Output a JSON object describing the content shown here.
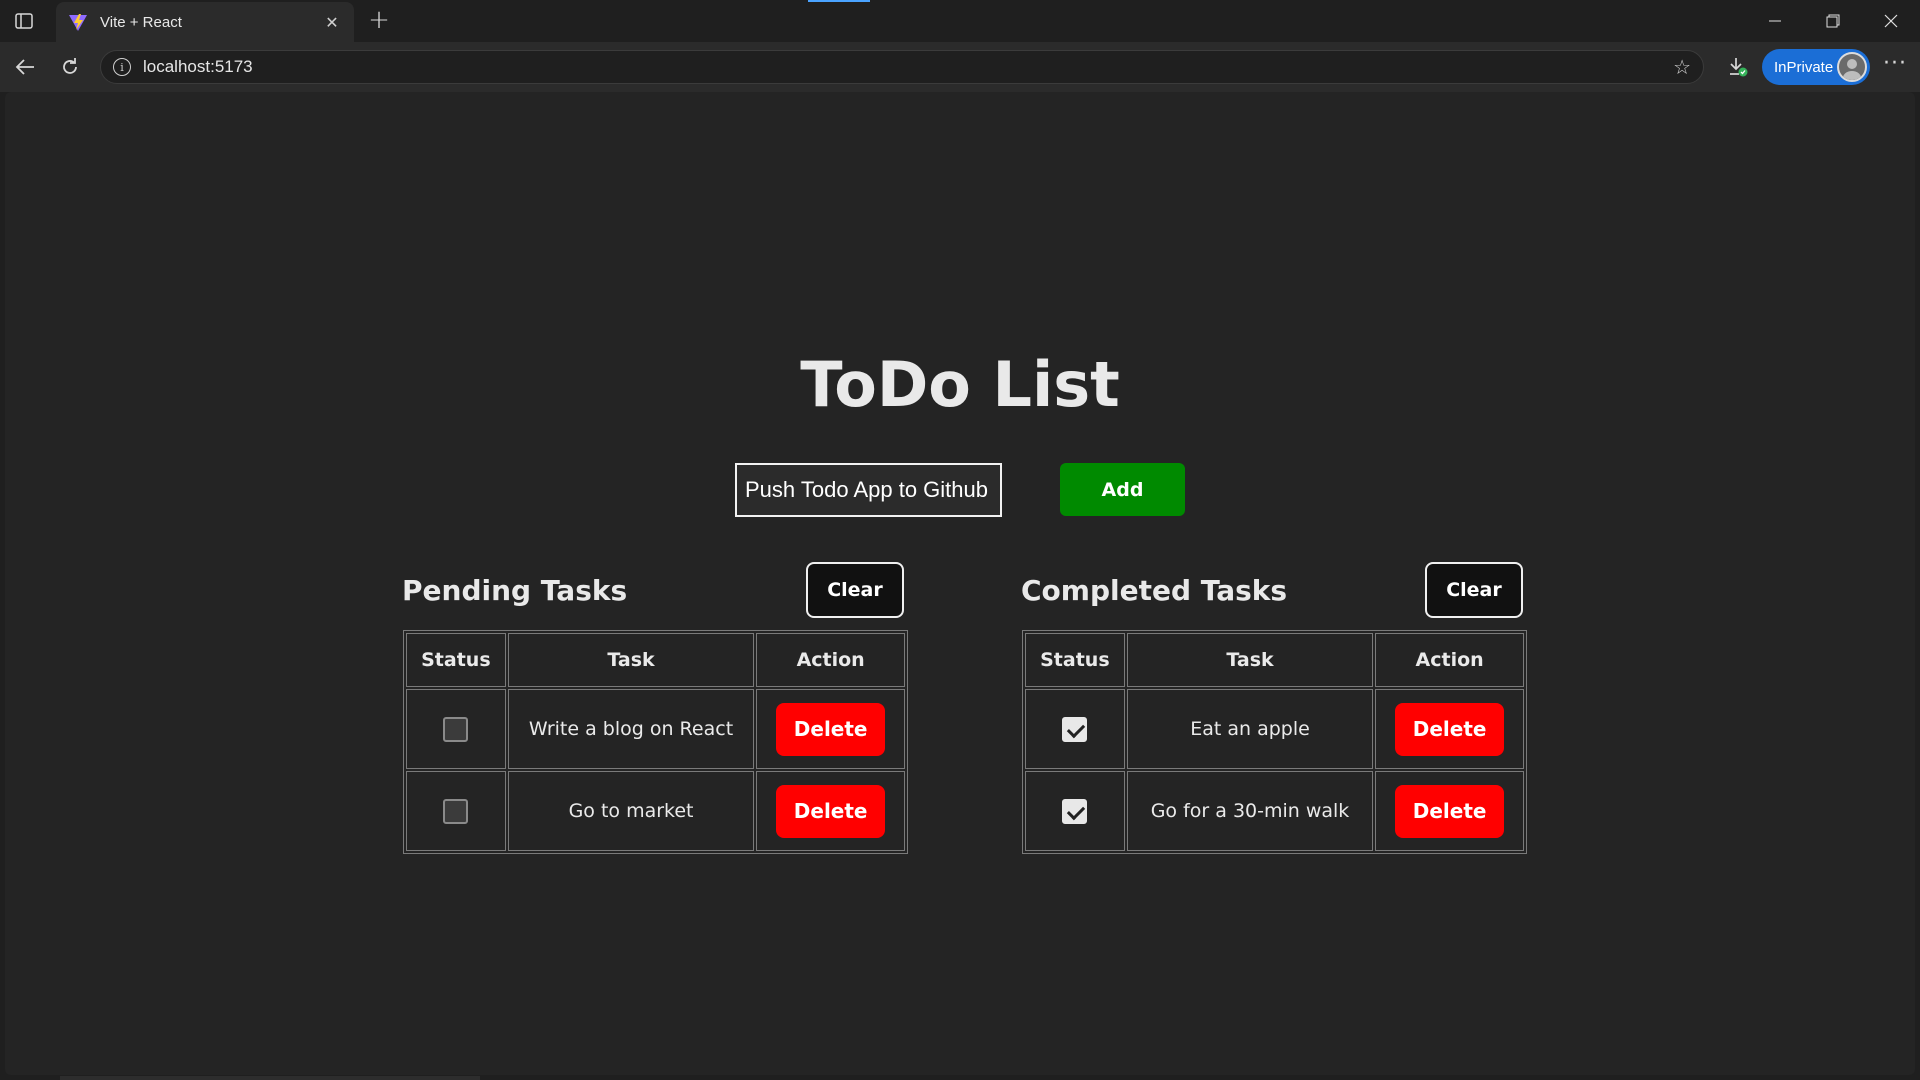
{
  "browser": {
    "tab_title": "Vite + React",
    "url": "localhost:5173",
    "profile_label": "InPrivate"
  },
  "app": {
    "title": "ToDo List",
    "input_value": "Push Todo App to Github",
    "add_label": "Add"
  },
  "pending": {
    "title": "Pending Tasks",
    "clear_label": "Clear",
    "headers": [
      "Status",
      "Task",
      "Action"
    ],
    "rows": [
      {
        "checked": false,
        "task": "Write a blog on React",
        "action": "Delete"
      },
      {
        "checked": false,
        "task": "Go to market",
        "action": "Delete"
      }
    ]
  },
  "completed": {
    "title": "Completed Tasks",
    "clear_label": "Clear",
    "headers": [
      "Status",
      "Task",
      "Action"
    ],
    "rows": [
      {
        "checked": true,
        "task": "Eat an apple",
        "action": "Delete"
      },
      {
        "checked": true,
        "task": "Go for a 30-min walk",
        "action": "Delete"
      }
    ]
  },
  "colors": {
    "add_button": "#008a00",
    "delete_button": "#ff0000",
    "page_background": "#242424",
    "inprivate_badge": "#1b6ed6"
  }
}
